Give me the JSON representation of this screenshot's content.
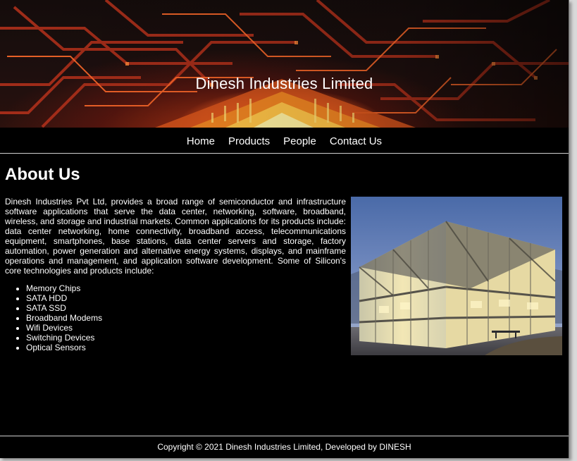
{
  "banner": {
    "title": "Dinesh Industries Limited"
  },
  "nav": {
    "items": [
      "Home",
      "Products",
      "People",
      "Contact Us"
    ]
  },
  "about": {
    "heading": "About Us",
    "paragraph": "Dinesh Industries Pvt Ltd, provides a broad range of semiconductor and infrastructure software applications that serve the data center, networking, software, broadband, wireless, and storage and industrial markets. Common applications for its products include: data center networking, home connectivity, broadband access, telecommunications equipment, smartphones, base stations, data center servers and storage, factory automation, power generation and alternative energy systems, displays, and mainframe operations and management, and application software development. Some of Silicon's core technologies and products include:",
    "products": [
      "Memory Chips",
      "SATA HDD",
      "SATA SSD",
      "Broadband Modems",
      "Wifi Devices",
      "Switching Devices",
      "Optical Sensors"
    ]
  },
  "footer": {
    "copyright": "Copyright © 2021 Dinesh Industries Limited, Developed by DINESH"
  },
  "colors": {
    "background": "#000000",
    "text": "#ffffff",
    "divider": "#cfcfcf",
    "banner_glow": "#ffb02a"
  }
}
